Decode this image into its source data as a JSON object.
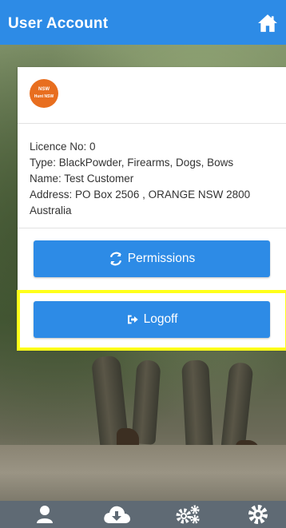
{
  "header": {
    "title": "User Account",
    "home_icon": "home-icon"
  },
  "card": {
    "logo": {
      "line1": "NSW",
      "line2": "Hunt NSW"
    },
    "info": {
      "licence": "Licence No: 0",
      "type": "Type: BlackPowder, Firearms, Dogs, Bows",
      "name": "Name: Test Customer",
      "address_line1": "Address: PO Box 2506 , ORANGE NSW 2800",
      "address_line2": "Australia"
    },
    "buttons": {
      "permissions": {
        "label": "Permissions",
        "icon": "refresh-icon"
      },
      "logoff": {
        "label": "Logoff",
        "icon": "sign-out-icon"
      }
    }
  },
  "bottom_nav": {
    "items": [
      {
        "icon": "user-icon"
      },
      {
        "icon": "cloud-download-icon"
      },
      {
        "icon": "gears-icon"
      },
      {
        "icon": "settings-icon"
      }
    ]
  },
  "colors": {
    "primary": "#2d8be6",
    "header": "#2d8be6",
    "nav_bg": "#5f6a74",
    "highlight": "#ffff1a",
    "logo_bg": "#e86e1f"
  }
}
